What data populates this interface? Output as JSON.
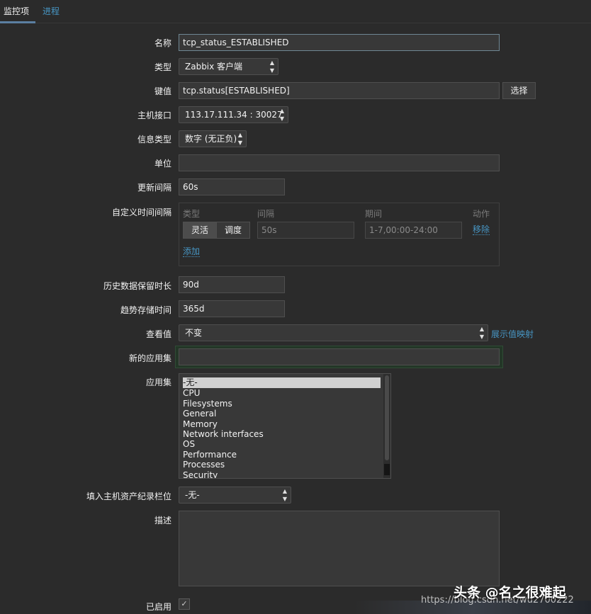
{
  "tabs": [
    {
      "label": "监控项"
    },
    {
      "label": "进程"
    }
  ],
  "form": {
    "name": {
      "label": "名称",
      "value": "tcp_status_ESTABLISHED"
    },
    "type": {
      "label": "类型",
      "value": "Zabbix 客户端"
    },
    "key": {
      "label": "键值",
      "value": "tcp.status[ESTABLISHED]",
      "button": "选择"
    },
    "host_interface": {
      "label": "主机接口",
      "value": "113.17.111.34 : 30027"
    },
    "info_type": {
      "label": "信息类型",
      "value": "数字 (无正负)"
    },
    "units": {
      "label": "单位",
      "value": ""
    },
    "update_interval": {
      "label": "更新间隔",
      "value": "60s"
    },
    "custom_intervals": {
      "label": "自定义时间间隔",
      "headers": {
        "type": "类型",
        "interval": "间隔",
        "period": "期间",
        "action": "动作"
      },
      "row": {
        "type_options": [
          "灵活",
          "调度"
        ],
        "selected_type": "灵活",
        "interval": "50s",
        "period": "1-7,00:00-24:00",
        "remove": "移除"
      },
      "add": "添加"
    },
    "history": {
      "label": "历史数据保留时长",
      "value": "90d"
    },
    "trends": {
      "label": "趋势存储时间",
      "value": "365d"
    },
    "show_value": {
      "label": "查看值",
      "value": "不变",
      "link": "展示值映射"
    },
    "new_application": {
      "label": "新的应用集",
      "value": ""
    },
    "applications": {
      "label": "应用集",
      "items": [
        "-无-",
        "CPU",
        "Filesystems",
        "General",
        "Memory",
        "Network interfaces",
        "OS",
        "Performance",
        "Processes",
        "Security"
      ],
      "selected": "-无-"
    },
    "inventory": {
      "label": "填入主机资产纪录栏位",
      "value": "-无-"
    },
    "description": {
      "label": "描述",
      "value": ""
    },
    "enabled": {
      "label": "已启用",
      "checked": true
    }
  },
  "watermark": {
    "main": "头条 @名之很难起",
    "url": "https://blog.csdn.net/wu2700222"
  }
}
